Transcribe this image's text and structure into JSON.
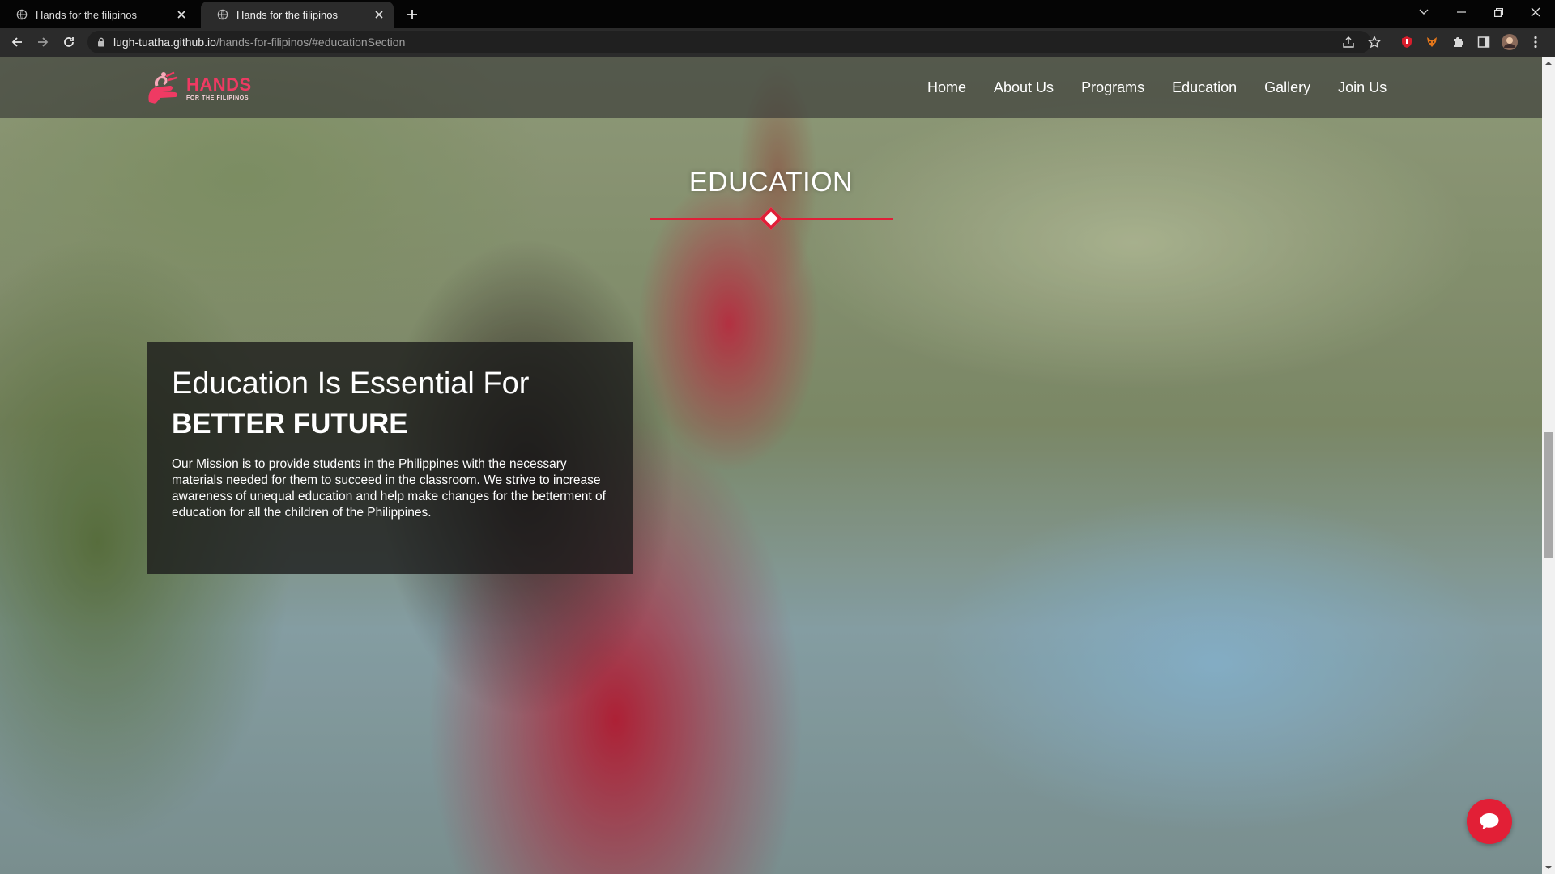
{
  "browser": {
    "tabs": [
      {
        "title": "Hands for the filipinos",
        "active": false
      },
      {
        "title": "Hands for the filipinos",
        "active": true
      }
    ],
    "url": {
      "host": "lugh-tuatha.github.io",
      "path": "/hands-for-filipinos/#educationSection"
    },
    "icons": {
      "back": "back-arrow-icon",
      "forward": "forward-arrow-icon",
      "reload": "reload-icon",
      "lock": "lock-icon",
      "share": "share-icon",
      "bookmark": "star-icon",
      "extensions": "puzzle-icon",
      "sidepanel": "side-panel-icon",
      "menu": "kebab-menu-icon"
    }
  },
  "site": {
    "logo": {
      "title": "HANDS",
      "subtitle": "FOR THE FILIPINOS"
    },
    "nav": [
      "Home",
      "About Us",
      "Programs",
      "Education",
      "Gallery",
      "Join Us"
    ],
    "section": {
      "title": "EDUCATION"
    },
    "info_box": {
      "heading_line1": "Education Is Essential For",
      "heading_line2": "BETTER FUTURE",
      "body": "Our Mission is to provide students in the Philippines with the necessary materials needed for them to succeed in the classroom. We strive to increase awareness of unequal education and help make changes for the betterment of education for all the children of the Philippines."
    },
    "colors": {
      "accent": "#e01f38",
      "logo": "#ef3a63"
    }
  }
}
